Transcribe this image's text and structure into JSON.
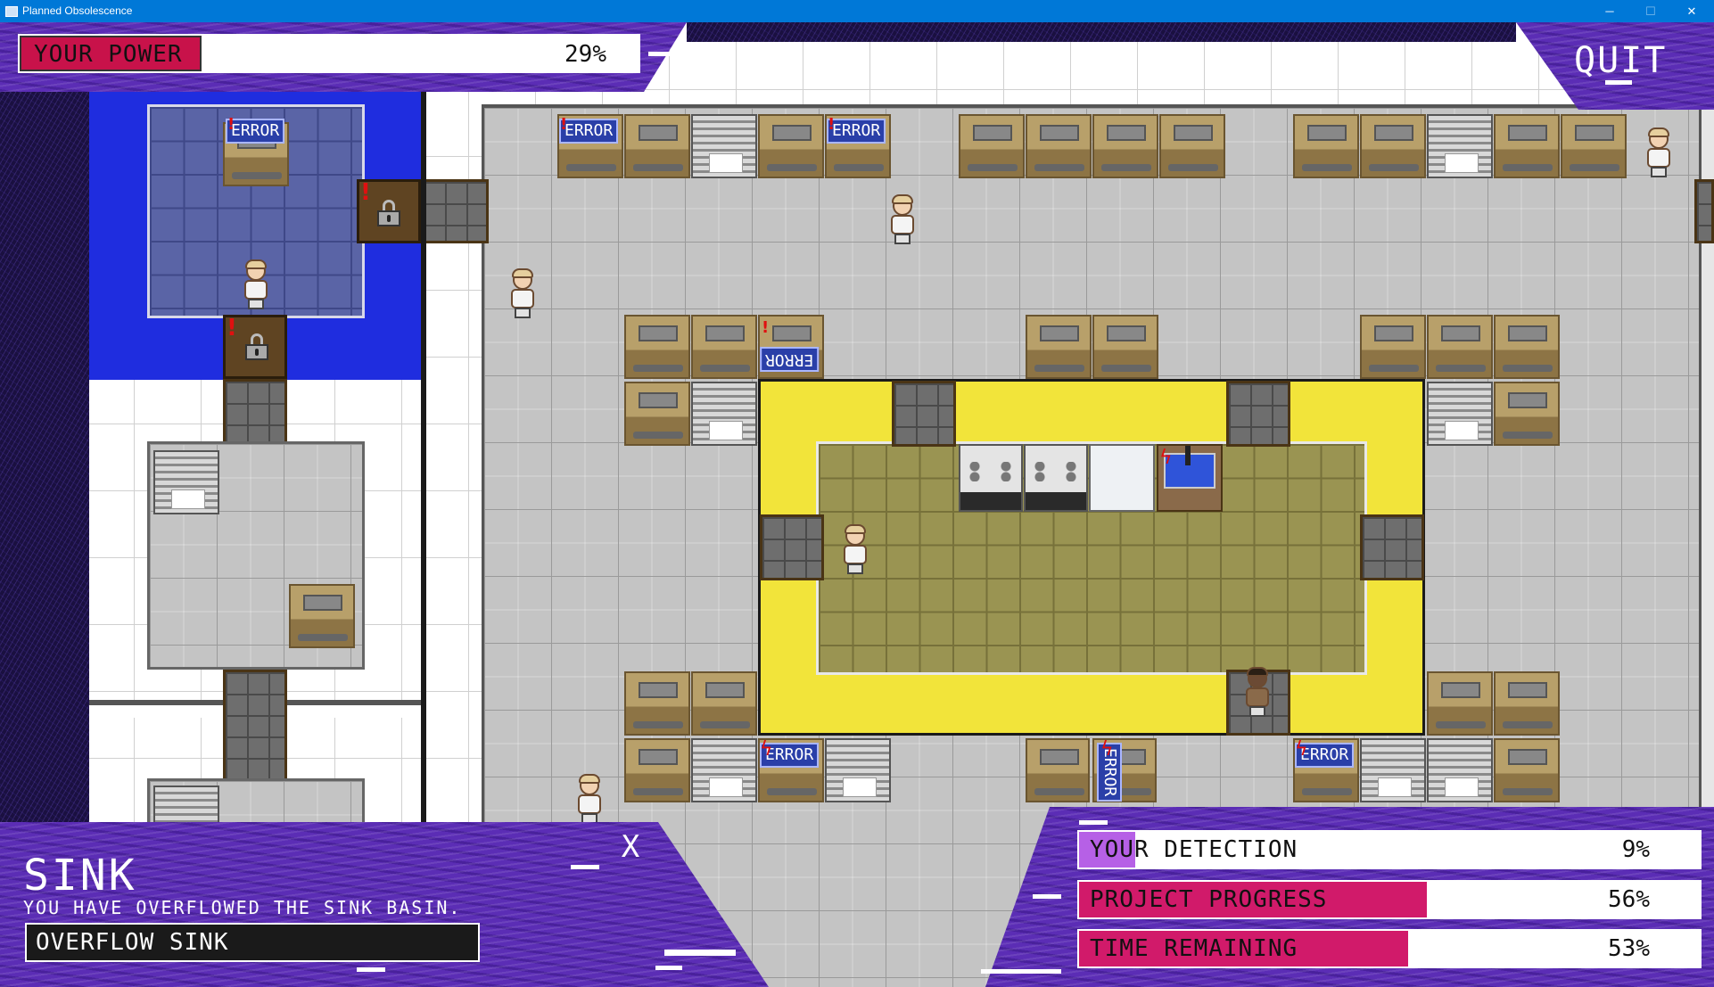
{
  "window": {
    "title": "Planned Obsolescence",
    "controls": {
      "minimize": "─",
      "maximize": "☐",
      "close": "✕"
    }
  },
  "hud": {
    "power": {
      "label": "YOUR POWER",
      "value_text": "29%",
      "value": 0.29,
      "color": "#c8124a"
    },
    "quit_label": "QUIT",
    "stats": [
      {
        "key": "detection",
        "label": "YOUR DETECTION",
        "value_text": "9%",
        "value": 0.09,
        "color": "#b660e6"
      },
      {
        "key": "progress",
        "label": "PROJECT PROGRESS",
        "value_text": "56%",
        "value": 0.56,
        "color": "#d11a6a"
      },
      {
        "key": "time",
        "label": "TIME REMAINING",
        "value_text": "53%",
        "value": 0.53,
        "color": "#d11a6a"
      }
    ]
  },
  "info_panel": {
    "title": "SINK",
    "description": "YOU HAVE OVERFLOWED THE SINK BASIN.",
    "action_label": "OVERFLOW SINK",
    "close_glyph": "X"
  },
  "map": {
    "error_label": "ERROR",
    "alert_glyph": "!",
    "bolt_glyph": "ϟ"
  },
  "colors": {
    "purple_panel": "#5b2db5",
    "blue_room": "#1f2ddf",
    "yellow_ring": "#f2e43a",
    "floor_gray": "#c4c4c4"
  }
}
